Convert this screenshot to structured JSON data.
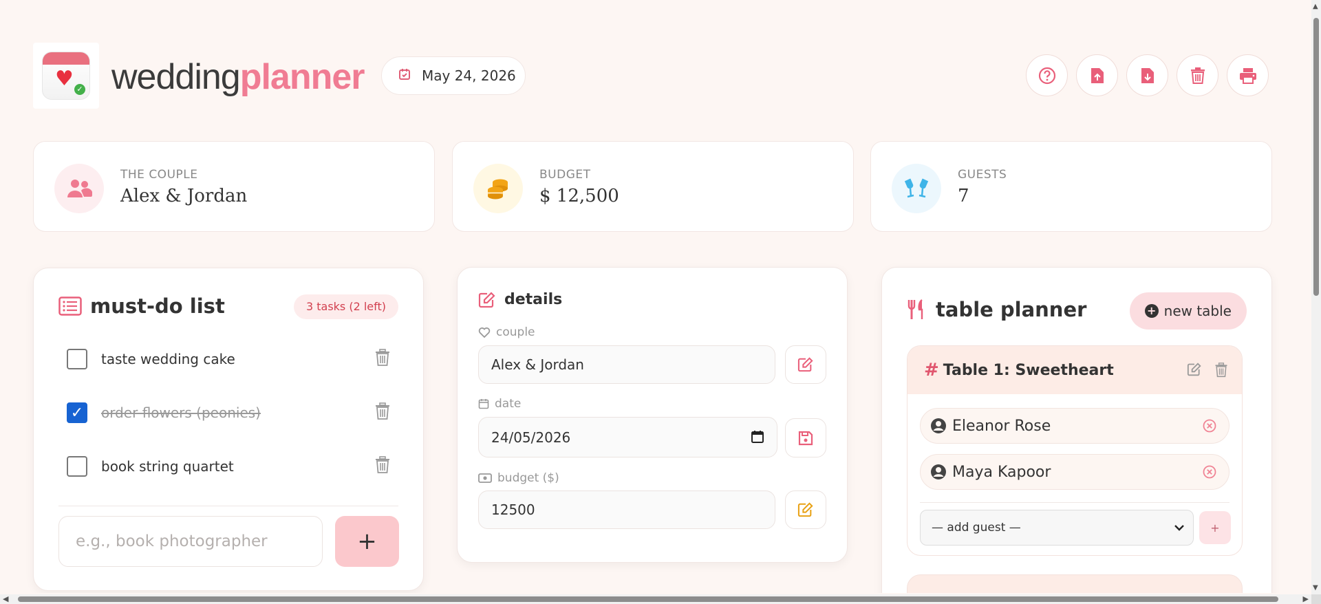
{
  "header": {
    "brand_light": "wedding",
    "brand_bold": "planner",
    "date": "May 24, 2026"
  },
  "stats": {
    "couple_label": "THE COUPLE",
    "couple_value": "Alex & Jordan",
    "budget_label": "BUDGET",
    "budget_value": "$ 12,500",
    "guests_label": "GUESTS",
    "guests_value": "7"
  },
  "todo": {
    "title": "must-do list",
    "badge": "3 tasks (2 left)",
    "items": [
      {
        "label": "taste wedding cake",
        "done": false
      },
      {
        "label": "order flowers (peonies)",
        "done": true
      },
      {
        "label": "book string quartet",
        "done": false
      }
    ],
    "new_placeholder": "e.g., book photographer",
    "add_label": "+"
  },
  "details": {
    "title": "details",
    "couple_label": "couple",
    "couple_value": "Alex & Jordan",
    "date_label": "date",
    "date_value": "24/05/2026",
    "budget_label": "budget ($)",
    "budget_value": "12500"
  },
  "tables": {
    "title": "table planner",
    "new_label": "new table",
    "table1": {
      "name": "Table 1: Sweetheart",
      "guests": [
        "Eleanor Rose",
        "Maya Kapoor"
      ],
      "add_guest_placeholder": "— add guest —",
      "add_label": "+"
    }
  },
  "colors": {
    "accent": "#f07c93",
    "checkbox": "#1763d2",
    "budget_icon": "#f2a416",
    "guests_icon": "#3fb4e8"
  }
}
